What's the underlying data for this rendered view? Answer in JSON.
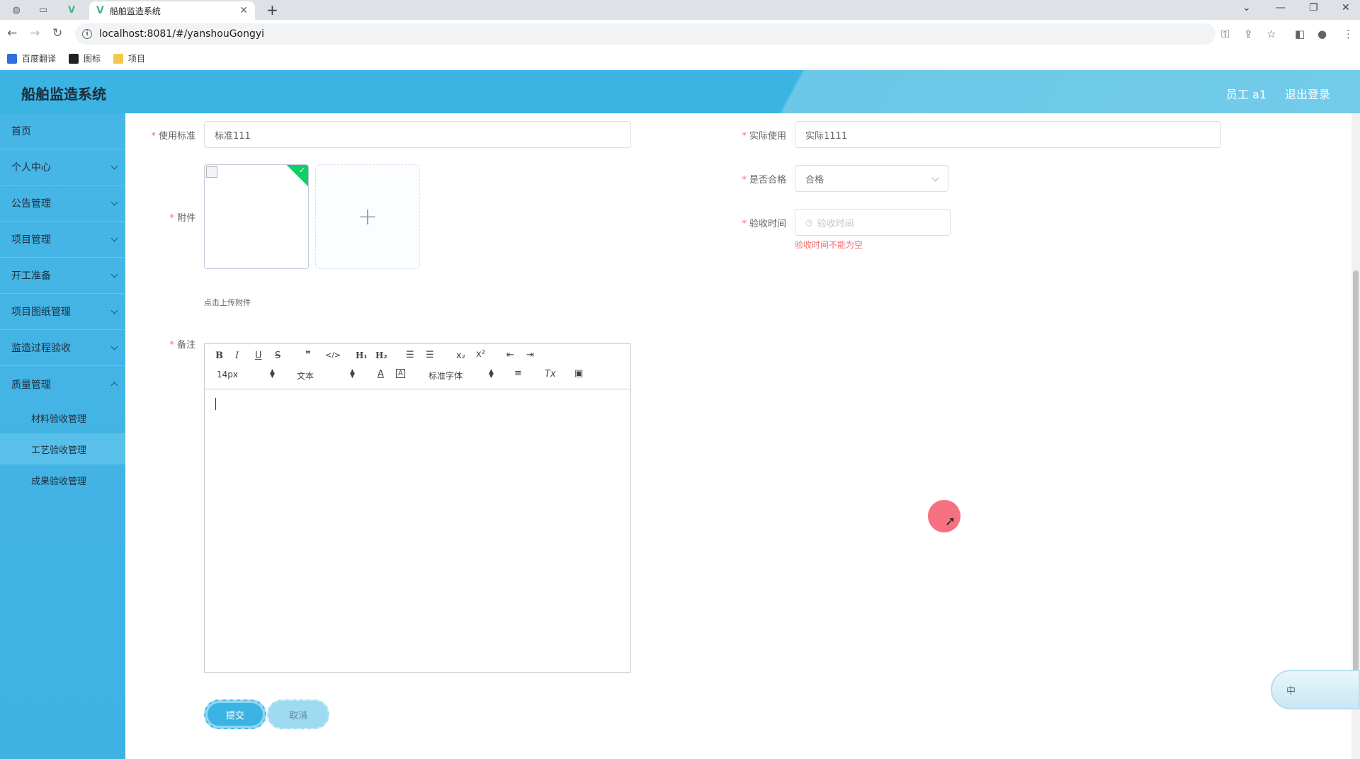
{
  "browser": {
    "active_tab_title": "船舶监造系统",
    "url": "localhost:8081/#/yanshouGongyi",
    "bookmarks": [
      {
        "label": "百度翻译",
        "color": "#2b6fe0"
      },
      {
        "label": "图标",
        "color": "#222222"
      },
      {
        "label": "项目",
        "color": "#f2c94c"
      }
    ]
  },
  "header": {
    "app_title": "船舶监造系统",
    "user": "员工 a1",
    "logout": "退出登录"
  },
  "sidebar": {
    "items": [
      {
        "label": "首页",
        "has_children": false
      },
      {
        "label": "个人中心",
        "has_children": true
      },
      {
        "label": "公告管理",
        "has_children": true
      },
      {
        "label": "项目管理",
        "has_children": true
      },
      {
        "label": "开工准备",
        "has_children": true
      },
      {
        "label": "项目图纸管理",
        "has_children": true
      },
      {
        "label": "监造过程验收",
        "has_children": true
      },
      {
        "label": "质量管理",
        "has_children": true
      }
    ],
    "submenu": [
      {
        "label": "材料验收管理",
        "active": false
      },
      {
        "label": "工艺验收管理",
        "active": true
      },
      {
        "label": "成果验收管理",
        "active": false
      }
    ]
  },
  "form": {
    "standard": {
      "label": "使用标准",
      "value": "标准111"
    },
    "actual": {
      "label": "实际使用",
      "value": "实际1111"
    },
    "qualified": {
      "label": "是否合格",
      "value": "合格"
    },
    "accept_time": {
      "label": "验收时间",
      "placeholder": "验收时间",
      "error": "验收时间不能为空"
    },
    "attachment": {
      "label": "附件",
      "hint": "点击上传附件"
    },
    "remark": {
      "label": "备注"
    },
    "required_mark": "*"
  },
  "editor": {
    "font_size": "14px",
    "header_select": "文本",
    "font_family": "标准字体"
  },
  "actions": {
    "submit": "提交",
    "cancel": "取消"
  },
  "ime": {
    "label": "中"
  }
}
